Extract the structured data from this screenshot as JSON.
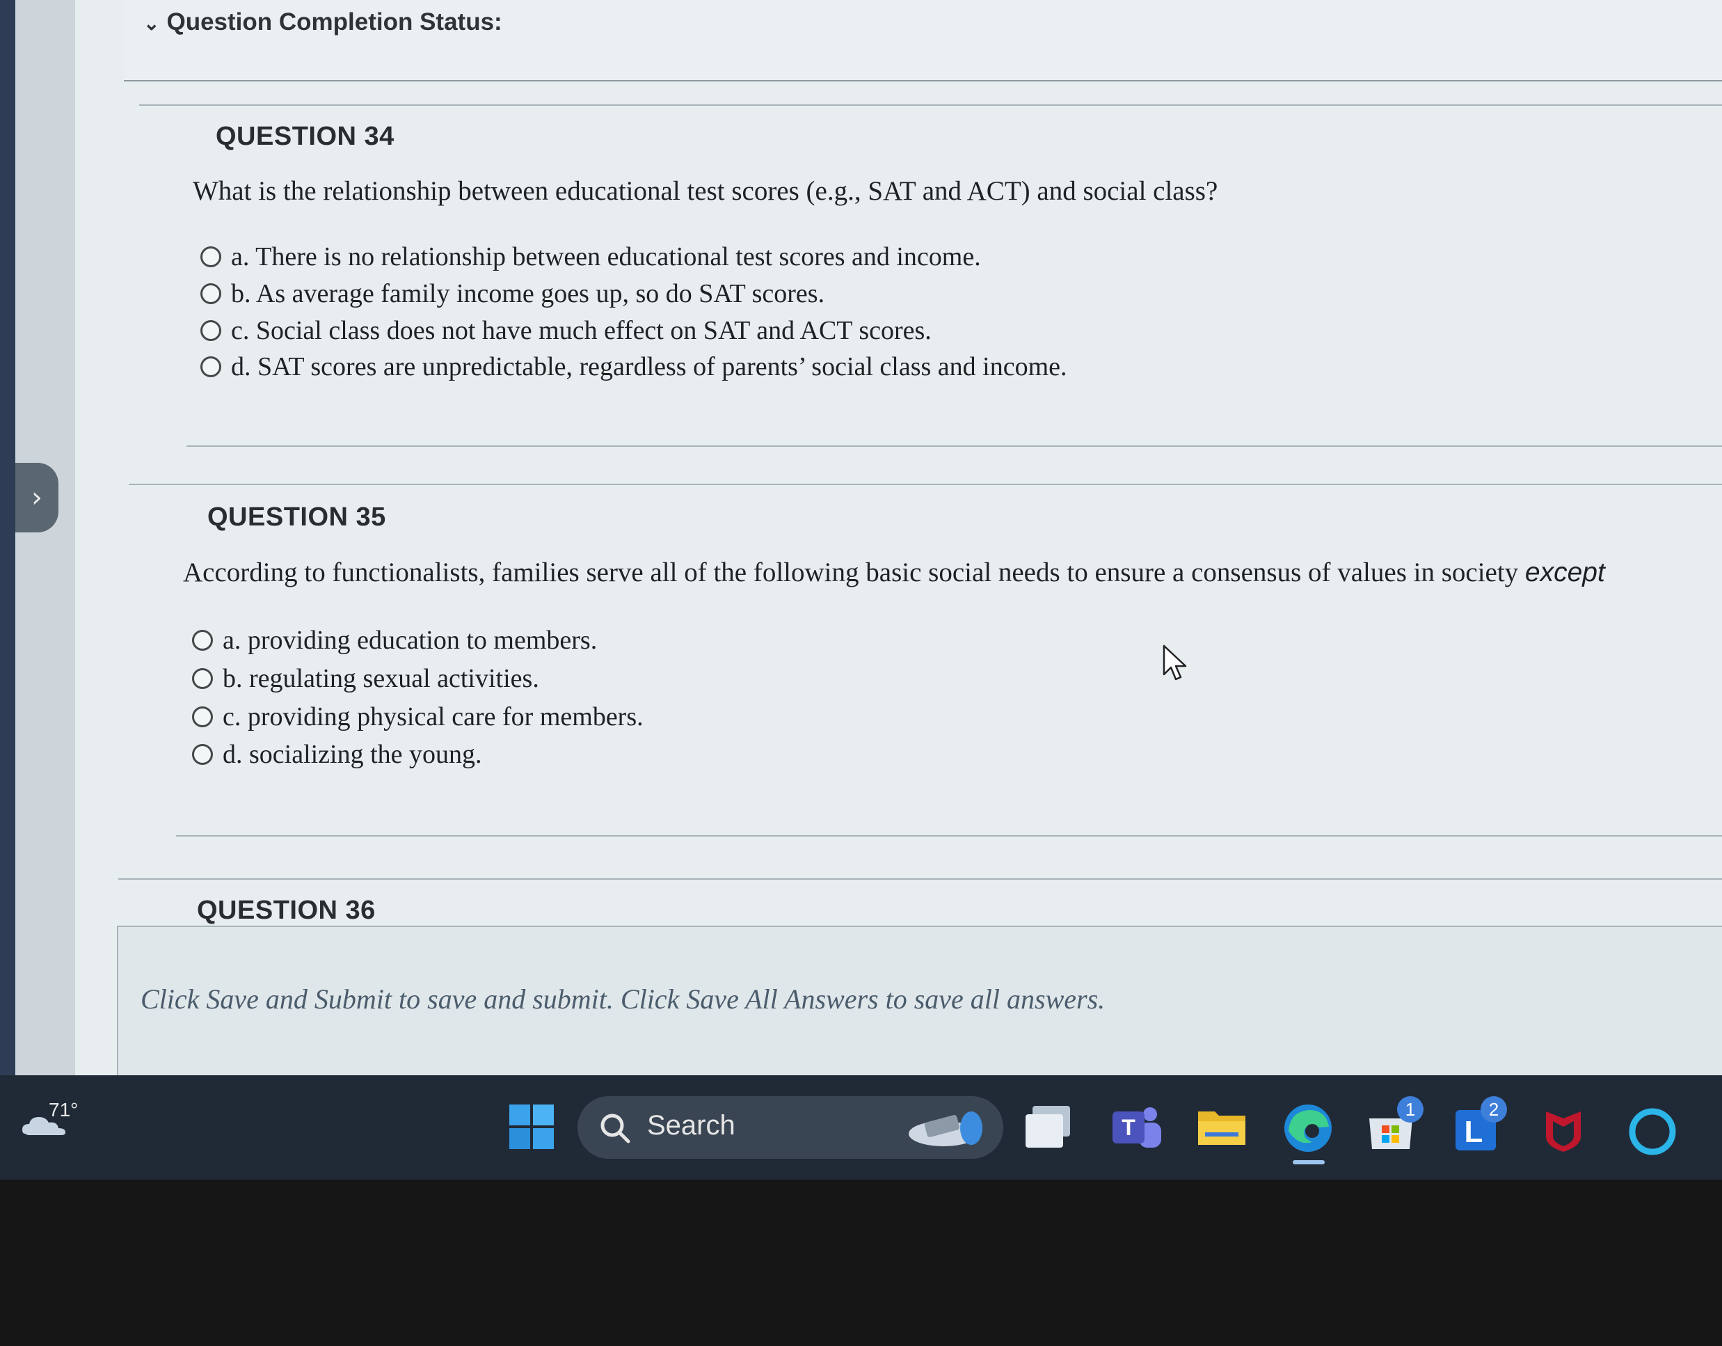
{
  "status": {
    "chevron": "⌄",
    "title": "Question Completion Status:"
  },
  "questions": [
    {
      "heading": "QUESTION 34",
      "text": "What is the relationship between educational test scores (e.g., SAT and ACT) and social class?",
      "options": [
        "a. There is no relationship between educational test scores and income.",
        "b. As average family income goes up, so do SAT scores.",
        "c. Social class does not have much effect on SAT and ACT scores.",
        "d. SAT scores are unpredictable, regardless of parents’ social class and income."
      ]
    },
    {
      "heading": "QUESTION 35",
      "text": "According to functionalists, families serve all of the following basic social needs to ensure a consensus of values in society",
      "text_emphasis": "except",
      "options": [
        "a. providing education to members.",
        "b. regulating sexual activities.",
        "c. providing physical care for members.",
        "d. socializing the young."
      ]
    },
    {
      "heading": "QUESTION 36"
    }
  ],
  "footer": {
    "instruction": "Click Save and Submit to save and submit. Click Save All Answers to save all answers."
  },
  "taskbar": {
    "weather": {
      "temp": "71°",
      "icon": "cloud-icon"
    },
    "search_label": "Search",
    "badges": {
      "store": "1",
      "app_l": "2"
    },
    "icons": [
      "windows-start-icon",
      "search-icon",
      "copilot-icon",
      "task-view-icon",
      "teams-icon",
      "file-explorer-icon",
      "edge-icon",
      "store-icon",
      "app-l-icon",
      "mcafee-icon",
      "circle-app-icon"
    ]
  }
}
